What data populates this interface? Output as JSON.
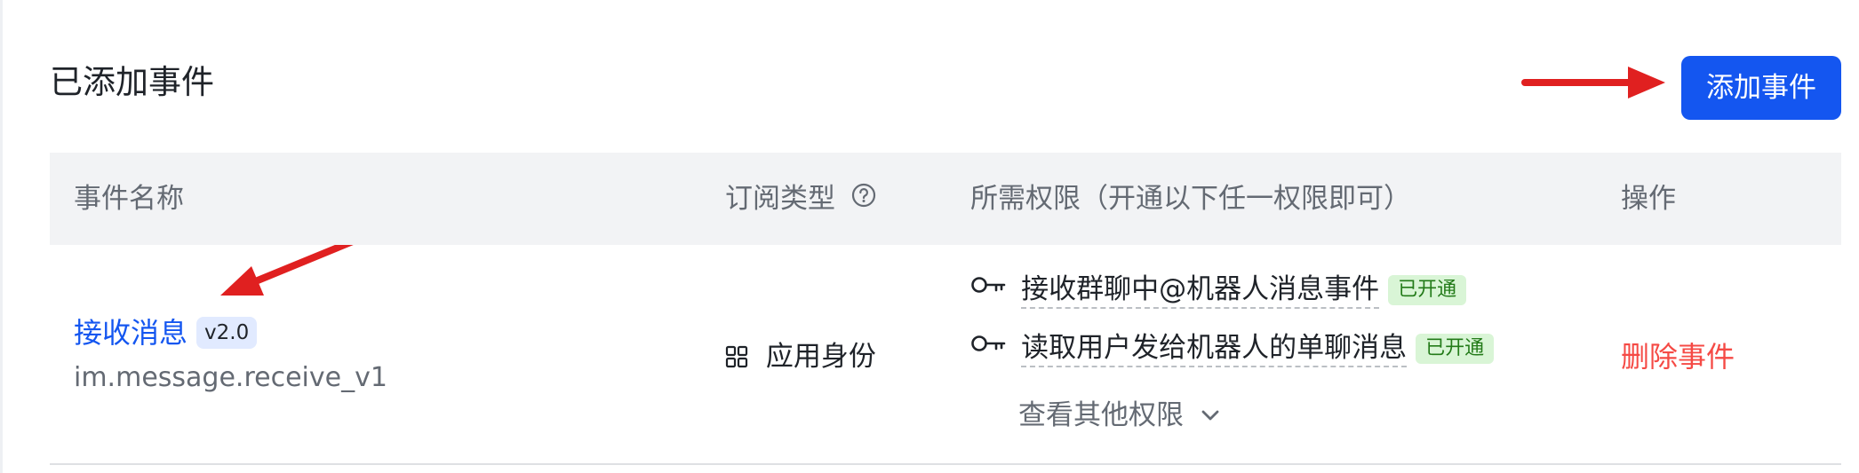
{
  "section": {
    "title": "已添加事件",
    "add_button_label": "添加事件"
  },
  "table": {
    "headers": {
      "event_name": "事件名称",
      "subscription_type": "订阅类型",
      "required_permissions": "所需权限（开通以下任一权限即可）",
      "actions": "操作"
    },
    "rows": [
      {
        "event_name": "接收消息",
        "version": "v2.0",
        "event_key": "im.message.receive_v1",
        "subscription_type": "应用身份",
        "permissions": [
          {
            "name": "接收群聊中@机器人消息事件",
            "status": "已开通"
          },
          {
            "name": "读取用户发给机器人的单聊消息",
            "status": "已开通"
          }
        ],
        "more_permissions_label": "查看其他权限",
        "delete_label": "删除事件"
      }
    ]
  },
  "colors": {
    "primary": "#1456f0",
    "danger": "#f54a45",
    "success_text": "#237b19",
    "success_bg": "#d9f5d6",
    "header_bg": "#f2f3f5",
    "annotation_arrow": "#e02020"
  },
  "icons": {
    "help": "question-circle-icon",
    "app_identity": "grid-icon",
    "permission": "key-icon",
    "expand": "chevron-down-icon"
  }
}
